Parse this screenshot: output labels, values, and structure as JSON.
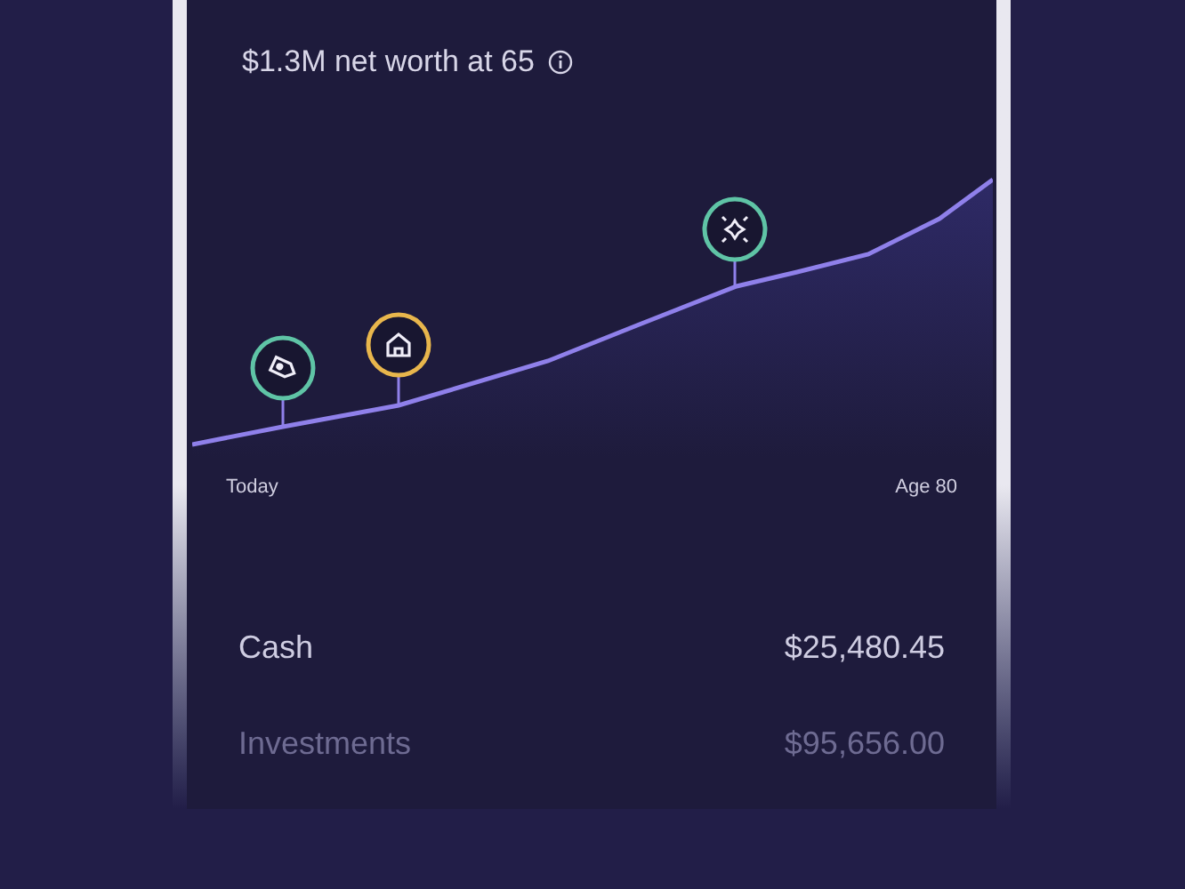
{
  "summary": {
    "subtitle": "$1.3M net worth at 65"
  },
  "chart": {
    "start_label": "Today",
    "end_label": "Age 80",
    "markers": [
      {
        "kind": "tag",
        "color": "#5fc4a6"
      },
      {
        "kind": "home",
        "color": "#e8b64c"
      },
      {
        "kind": "sparkle",
        "color": "#5fc4a6"
      }
    ]
  },
  "accounts": [
    {
      "name": "Cash",
      "amount": "$25,480.45",
      "faded": false
    },
    {
      "name": "Investments",
      "amount": "$95,656.00",
      "faded": true
    }
  ]
}
